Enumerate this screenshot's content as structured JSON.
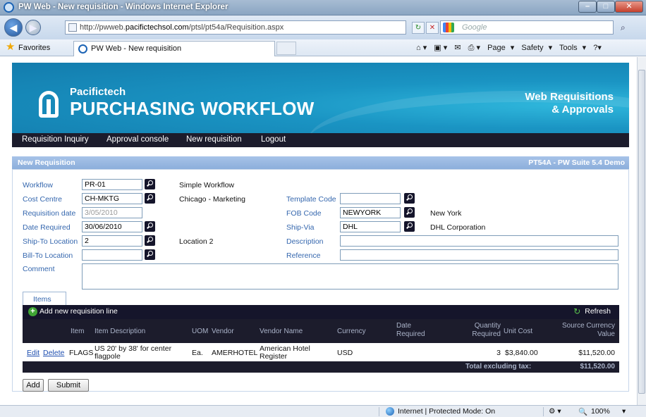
{
  "browser": {
    "window_title": "PW Web - New requisition - Windows Internet Explorer",
    "url_prefix": "http://pwweb.",
    "url_host": "pacifictechsol.com",
    "url_path": "/ptsl/pt54a/Requisition.aspx",
    "search_placeholder": "Google",
    "favorites_label": "Favorites",
    "tab_title": "PW Web - New requisition",
    "commands": [
      "Page",
      "Safety",
      "Tools"
    ],
    "status_zone": "Internet | Protected Mode: On",
    "zoom": "100%"
  },
  "banner": {
    "brand_small": "Pacifictech",
    "brand_big": "PURCHASING WORKFLOW",
    "tagline_1": "Web Requisitions",
    "tagline_2": "& Approvals"
  },
  "menu": [
    "Requisition Inquiry",
    "Approval console",
    "New requisition",
    "Logout"
  ],
  "section": {
    "title": "New Requisition",
    "version": "PT54A - PW Suite 5.4 Demo"
  },
  "form": {
    "workflow": {
      "label": "Workflow",
      "value": "PR-01",
      "desc": "Simple Workflow"
    },
    "cost_centre": {
      "label": "Cost Centre",
      "value": "CH-MKTG",
      "desc": "Chicago - Marketing"
    },
    "req_date": {
      "label": "Requisition date",
      "value": "3/05/2010"
    },
    "date_required": {
      "label": "Date Required",
      "value": "30/06/2010"
    },
    "ship_to": {
      "label": "Ship-To Location",
      "value": "2",
      "desc": "Location 2"
    },
    "bill_to": {
      "label": "Bill-To Location",
      "value": ""
    },
    "comment": {
      "label": "Comment",
      "value": ""
    },
    "template_code": {
      "label": "Template Code",
      "value": ""
    },
    "fob_code": {
      "label": "FOB Code",
      "value": "NEWYORK",
      "desc": "New York"
    },
    "ship_via": {
      "label": "Ship-Via",
      "value": "DHL",
      "desc": "DHL Corporation"
    },
    "description": {
      "label": "Description",
      "value": ""
    },
    "reference": {
      "label": "Reference",
      "value": ""
    }
  },
  "items": {
    "tab_label": "Items",
    "add_line": "Add new requisition line",
    "refresh": "Refresh",
    "columns": {
      "item": "Item",
      "item_desc": "Item Description",
      "uom": "UOM",
      "vendor": "Vendor",
      "vendor_name": "Vendor Name",
      "currency": "Currency",
      "date_req_1": "Date",
      "date_req_2": "Required",
      "qty_1": "Quantity",
      "qty_2": "Required",
      "unit_cost": "Unit Cost",
      "src_val_1": "Source Currency",
      "src_val_2": "Value"
    },
    "rows": [
      {
        "edit": "Edit",
        "delete": "Delete",
        "item": "FLAGS",
        "desc_1": "US 20' by 38' for center",
        "desc_2": "flagpole",
        "uom": "Ea.",
        "vendor": "AMERHOTEL",
        "vendor_name_1": "American Hotel",
        "vendor_name_2": "Register",
        "currency": "USD",
        "qty": "3",
        "unit_cost": "$3,840.00",
        "value": "$11,520.00"
      }
    ],
    "total_label": "Total excluding tax:",
    "total_value": "$11,520.00"
  },
  "buttons": {
    "add": "Add",
    "submit": "Submit"
  }
}
